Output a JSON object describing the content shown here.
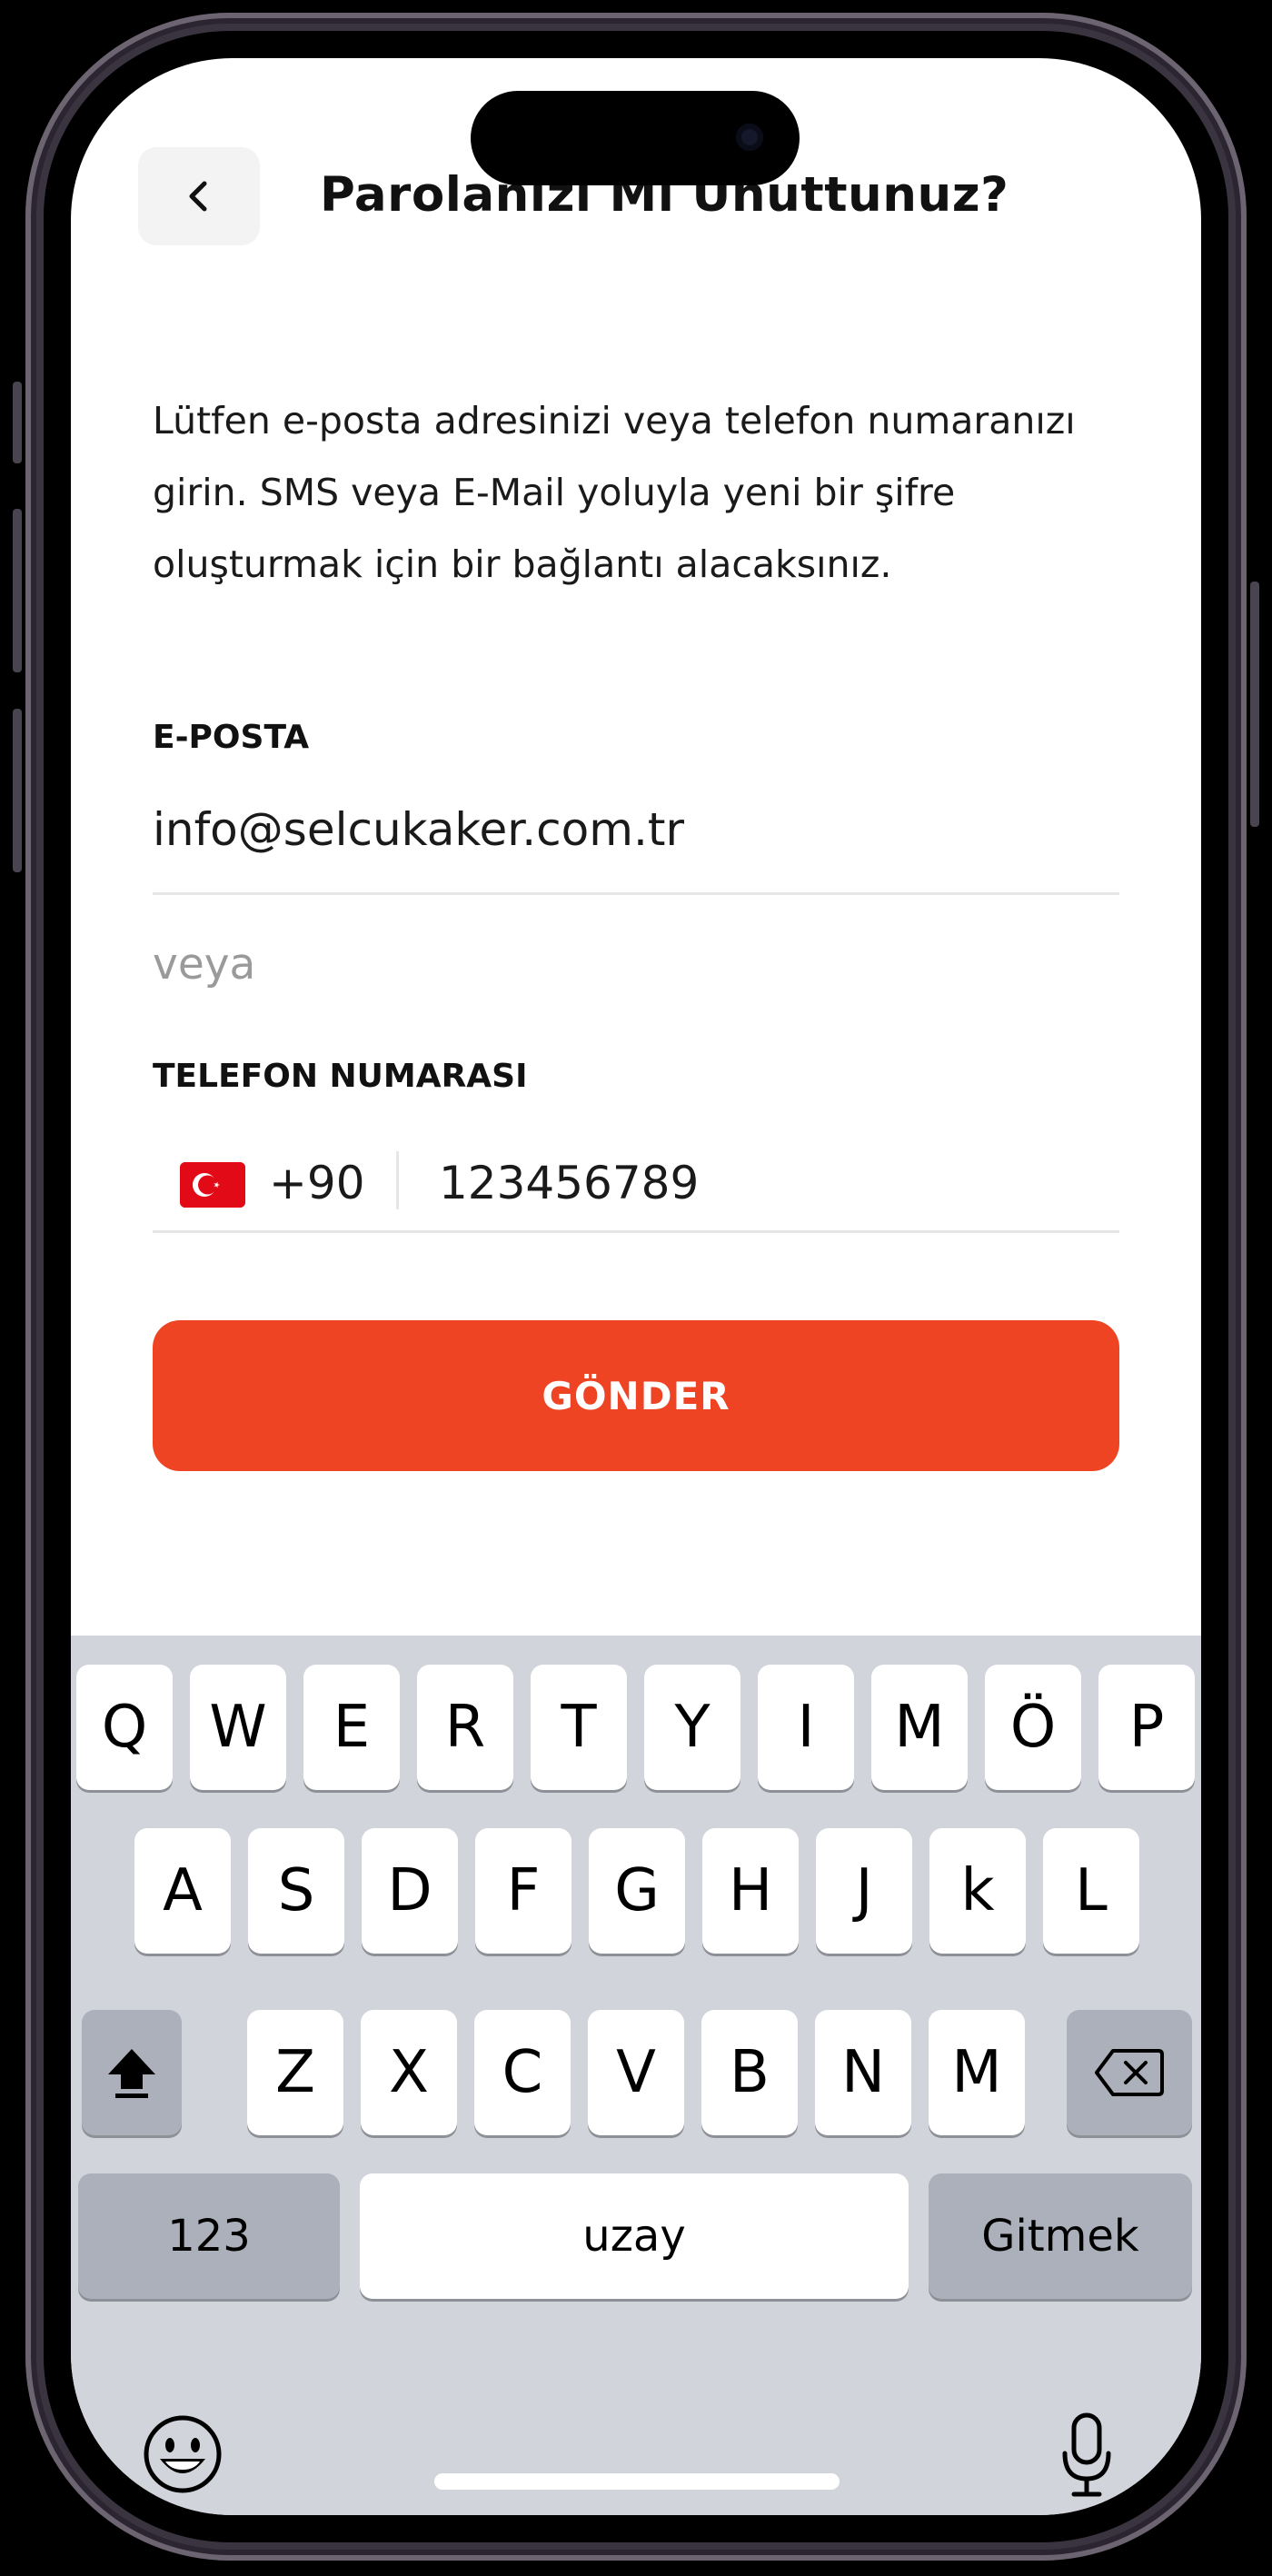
{
  "header": {
    "title": "Parolanızı Mı Unuttunuz?"
  },
  "intro_lines": [
    "Lütfen e-posta adresinizi veya telefon numaranızı",
    "girin. SMS veya E-Mail yoluyla yeni bir şifre",
    "oluşturmak için bir bağlantı alacaksınız."
  ],
  "email": {
    "label": "E-POSTA",
    "value": "info@selcukaker.com.tr"
  },
  "separator": "veya",
  "phone": {
    "label": "TELEFON NUMARASI",
    "country_code": "+90",
    "value": "123456789"
  },
  "submit_label": "GÖNDER",
  "keyboard": {
    "row1": [
      "Q",
      "W",
      "E",
      "R",
      "T",
      "Y",
      "I",
      "M",
      "Ö",
      "P"
    ],
    "row2": [
      "A",
      "S",
      "D",
      "F",
      "G",
      "H",
      "J",
      "k",
      "L"
    ],
    "row3": [
      "Z",
      "X",
      "C",
      "V",
      "B",
      "N",
      "M"
    ],
    "numbers": "123",
    "space": "uzay",
    "go": "Gitmek"
  },
  "colors": {
    "accent": "#ee4423",
    "keyboard_bg": "#d1d4da"
  }
}
